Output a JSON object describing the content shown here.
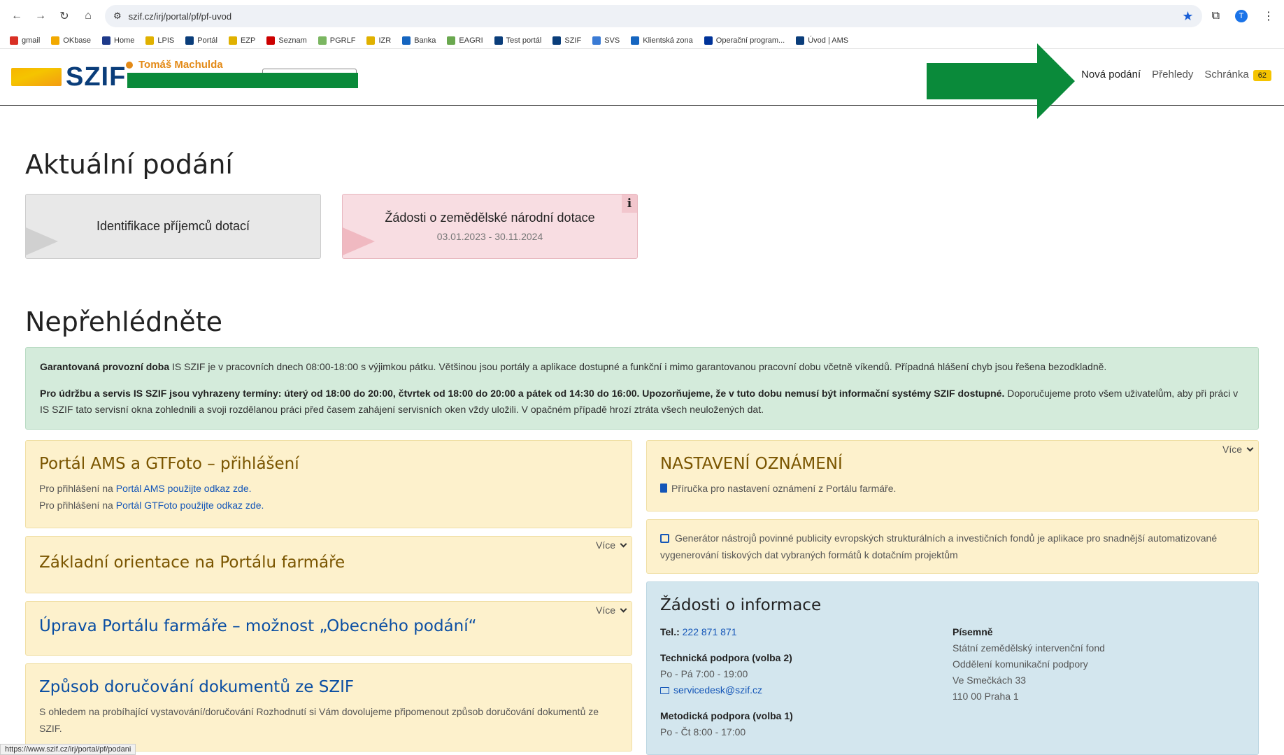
{
  "browser": {
    "url": "szif.cz/irj/portal/pf/pf-uvod",
    "profile_initial": "T",
    "bookmarks": [
      "gmail",
      "OKbase",
      "Home",
      "LPIS",
      "Portál",
      "EZP",
      "Seznam",
      "PGRLF",
      "IZR",
      "Banka",
      "EAGRI",
      "Test portál",
      "SZIF",
      "SVS",
      "Klientská zona",
      "Operační program...",
      "Úvod | AMS"
    ],
    "status_url": "https://www.szif.cz/irj/portal/pf/podani"
  },
  "header": {
    "logo_text": "SZIF",
    "user_name": "Tomáš Machulda",
    "nav": {
      "new": "Nová podání",
      "overview": "Přehledy",
      "inbox": "Schránka",
      "inbox_count": "62"
    }
  },
  "current": {
    "title": "Aktuální podání",
    "tiles": [
      {
        "title": "Identifikace příjemců dotací"
      },
      {
        "title": "Žádosti o zemědělské národní dotace",
        "dates": "03.01.2023 - 30.11.2024",
        "info": "i"
      }
    ]
  },
  "dont_miss": {
    "title": "Nepřehlédněte",
    "notice_p1_bold": "Garantovaná provozní doba",
    "notice_p1": " IS SZIF je v pracovních dnech 08:00-18:00 s výjimkou pátku. Většinou jsou portály a aplikace dostupné a funkční i mimo garantovanou pracovní dobu včetně víkendů. Případná hlášení chyb jsou řešena bezodkladně.",
    "notice_p2_bold": "Pro údržbu a servis IS SZIF jsou vyhrazeny termíny: úterý od 18:00 do 20:00, čtvrtek od 18:00 do 20:00 a pátek od 14:30 do 16:00. Upozorňujeme, že v tuto dobu nemusí být informační systémy SZIF dostupné.",
    "notice_p2": " Doporučujeme proto všem uživatelům, aby při práci v IS SZIF tato servisní okna zohlednili a svoji rozdělanou práci před časem zahájení servisních oken vždy uložili. V opačném případě hrozí ztráta všech neuložených dat."
  },
  "cards": {
    "ams": {
      "title": "Portál AMS a GTFoto – přihlášení",
      "line1_prefix": "Pro přihlášení na ",
      "line1_link": "Portál AMS použijte odkaz zde.",
      "line2_prefix": "Pro přihlášení na ",
      "line2_link": "Portál GTFoto použijte odkaz zde."
    },
    "orientation": {
      "title": "Základní orientace na Portálu farmáře",
      "more": "Více"
    },
    "upgrade": {
      "title": "Úprava Portálu farmáře – možnost „Obecného podání“",
      "more": "Více"
    },
    "delivery": {
      "title": "Způsob doručování dokumentů ze SZIF",
      "text": "S ohledem na probíhající vystavování/doručování Rozhodnutí si Vám dovolujeme připomenout způsob doručování dokumentů ze SZIF."
    },
    "notifications": {
      "title": "NASTAVENÍ OZNÁMENÍ",
      "more": "Více",
      "link": "Příručka pro nastavení oznámení z Portálu farmáře."
    },
    "generator": {
      "text": "Generátor nástrojů povinné publicity evropských strukturálních a investičních fondů je aplikace pro snadnější automatizované vygenerování tiskových dat vybraných formátů k dotačním projektům"
    },
    "contact": {
      "title": "Žádosti o informace",
      "tel_label": "Tel.:",
      "tel": "222 871 871",
      "tech_label": "Technická podpora (volba 2)",
      "tech_hours": "Po - Pá 7:00 - 19:00",
      "tech_email": "servicedesk@szif.cz",
      "method_label": "Metodická podpora (volba 1)",
      "method_hours": "Po - Čt 8:00 - 17:00",
      "written_label": "Písemně",
      "addr1": "Státní zemědělský intervenční fond",
      "addr2": "Oddělení komunikační podpory",
      "addr3": "Ve Smečkách 33",
      "addr4": "110 00 Praha 1"
    }
  },
  "colors": {
    "arrow": "#0a8a3a",
    "badge": "#f5c400",
    "notice_bg": "#d4ebdb",
    "card_bg": "#fdf1cc",
    "contact_bg": "#d3e6ee"
  }
}
